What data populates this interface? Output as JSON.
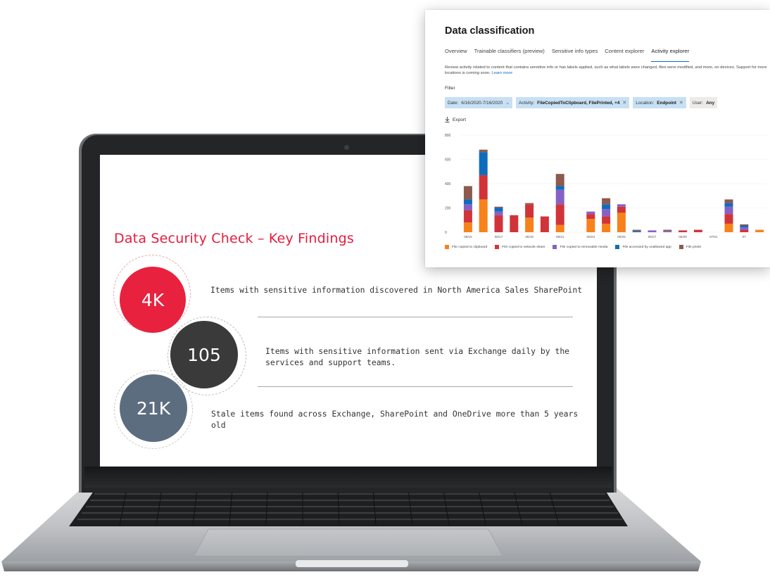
{
  "slide": {
    "title": "Data Security Check – Key Findings",
    "findings": [
      {
        "value": "4K",
        "text": "Items with sensitive information discovered in North America Sales SharePoint",
        "color": "#e8213f"
      },
      {
        "value": "105",
        "text_line1": "Items with sensitive information sent via Exchange daily by the",
        "text_line2": "services and support teams.",
        "color": "#3a3a3a"
      },
      {
        "value": "21K",
        "text": "Stale items found across Exchange, SharePoint and OneDrive more than 5 years old",
        "color": "#5d6d80"
      }
    ]
  },
  "panel": {
    "title": "Data classification",
    "tabs": [
      "Overview",
      "Trainable classifiers (preview)",
      "Sensitive info types",
      "Content explorer",
      "Activity explorer"
    ],
    "active_tab": "Activity explorer",
    "description": "Review activity related to content that contains sensitive info or has labels applied, such as what labels were changed, files were modified, and more, on devices. Support for more locations is coming soon.",
    "learn_more": "Learn more",
    "filter_label": "Filter",
    "filters": [
      {
        "label": "Date:",
        "value": "6/16/2020-7/16/2020",
        "icon": "chevron-down-icon"
      },
      {
        "label": "Activity:",
        "value": "FileCopiedToClipboard, FilePrinted, +4",
        "icon": "close-icon"
      },
      {
        "label": "Location:",
        "value": "Endpoint",
        "icon": "close-icon"
      },
      {
        "label": "User:",
        "value": "Any",
        "icon": ""
      }
    ],
    "export_label": "Export"
  },
  "chart_data": {
    "type": "bar",
    "stacked": true,
    "ylim": [
      0,
      800
    ],
    "y_ticks": [
      "800",
      "600",
      "400",
      "200",
      "0"
    ],
    "x_tick_labels": [
      {
        "label": "06/15",
        "index": 0
      },
      {
        "label": "06/17",
        "index": 2
      },
      {
        "label": "06/19",
        "index": 4
      },
      {
        "label": "06/21",
        "index": 6
      },
      {
        "label": "06/23",
        "index": 8
      },
      {
        "label": "06/25",
        "index": 10
      },
      {
        "label": "06/27",
        "index": 12
      },
      {
        "label": "06/29",
        "index": 14
      },
      {
        "label": "07/01",
        "index": 16
      },
      {
        "label": "07",
        "index": 18
      }
    ],
    "series": [
      {
        "name": "File copied to clipboard",
        "color": "#f7821b",
        "values": [
          80,
          270,
          0,
          0,
          120,
          0,
          60,
          0,
          110,
          70,
          160,
          0,
          0,
          0,
          0,
          0,
          0,
          70,
          0,
          20
        ]
      },
      {
        "name": "File copied to network share",
        "color": "#d13438",
        "values": [
          100,
          200,
          140,
          140,
          110,
          130,
          170,
          0,
          40,
          60,
          50,
          0,
          0,
          0,
          15,
          20,
          0,
          80,
          20,
          0
        ]
      },
      {
        "name": "File copied to removable media",
        "color": "#8661c5",
        "values": [
          50,
          0,
          30,
          0,
          0,
          0,
          120,
          0,
          20,
          60,
          20,
          0,
          15,
          10,
          0,
          0,
          0,
          60,
          20,
          0
        ]
      },
      {
        "name": "File accessed by unallowed app",
        "color": "#0f6cbd",
        "values": [
          40,
          190,
          30,
          0,
          0,
          0,
          30,
          0,
          0,
          40,
          0,
          10,
          0,
          0,
          0,
          0,
          0,
          30,
          15,
          0
        ]
      },
      {
        "name": "File printed",
        "color": "#8c5a4e",
        "values": [
          110,
          20,
          10,
          0,
          10,
          0,
          100,
          0,
          0,
          50,
          0,
          10,
          0,
          10,
          0,
          0,
          0,
          30,
          10,
          0
        ]
      }
    ],
    "legend_labels": [
      "File copied to clipboard",
      "File copied to network share",
      "File copied to removable media",
      "File accessed by unallowed app",
      "File printe"
    ]
  }
}
